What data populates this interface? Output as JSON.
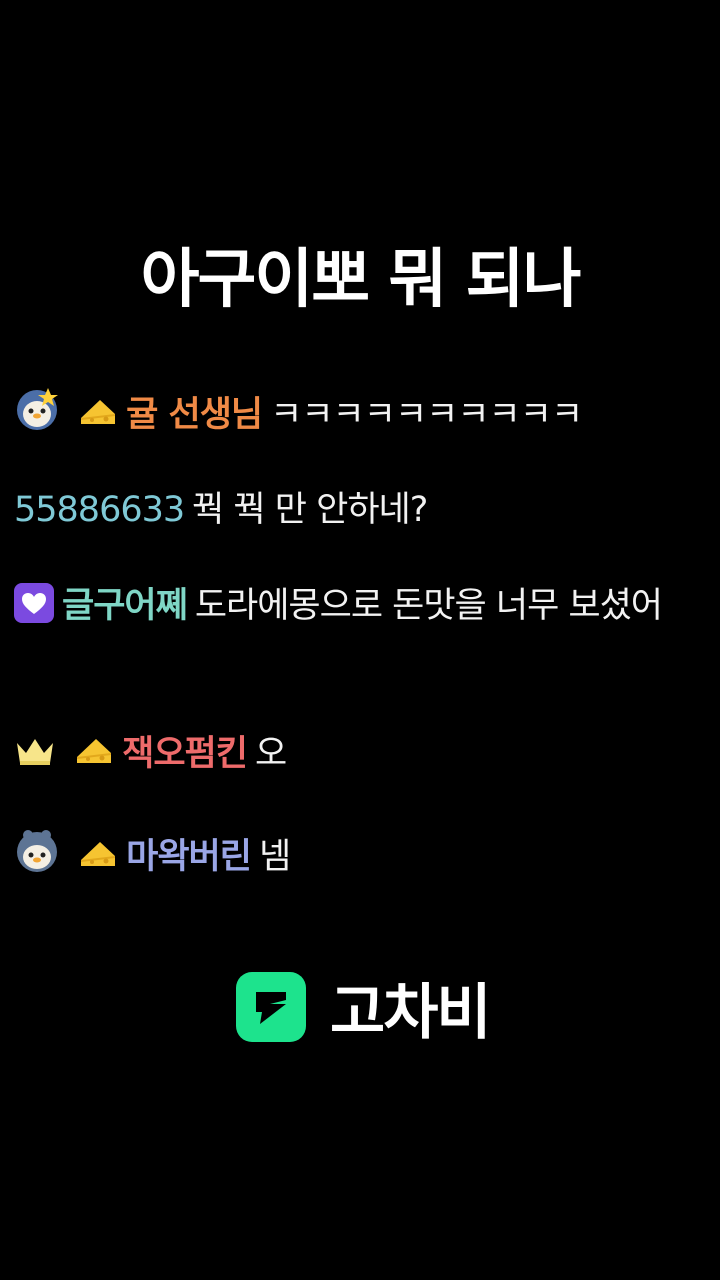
{
  "title": "아구이뽀 뭐 되나",
  "messages": [
    {
      "nick": "귤 선생님",
      "nick_color": "#f08a46",
      "text": "ㅋㅋㅋㅋㅋㅋㅋㅋㅋㅋ",
      "badges": [
        "penguin-star-icon",
        "cheese-icon"
      ]
    },
    {
      "nick": "55886633",
      "nick_color": "#7fc9d6",
      "text": "꿕 꿕 만 안하네?",
      "badges": []
    },
    {
      "nick": "글구어쪠",
      "nick_color": "#7fd6c6",
      "text": "도라에몽으로 돈맛을 너무 보셨어",
      "badges": [
        "purple-heart-icon"
      ]
    },
    {
      "nick": "잭오펌킨",
      "nick_color": "#ee6b6b",
      "text": "오",
      "badges": [
        "crown-icon",
        "cheese-icon"
      ]
    },
    {
      "nick": "마왁버린",
      "nick_color": "#9aa6e6",
      "text": "넴",
      "badges": [
        "penguin-hood-icon",
        "cheese-icon"
      ]
    }
  ],
  "brand": {
    "name": "고차비",
    "color": "#1de38d"
  }
}
